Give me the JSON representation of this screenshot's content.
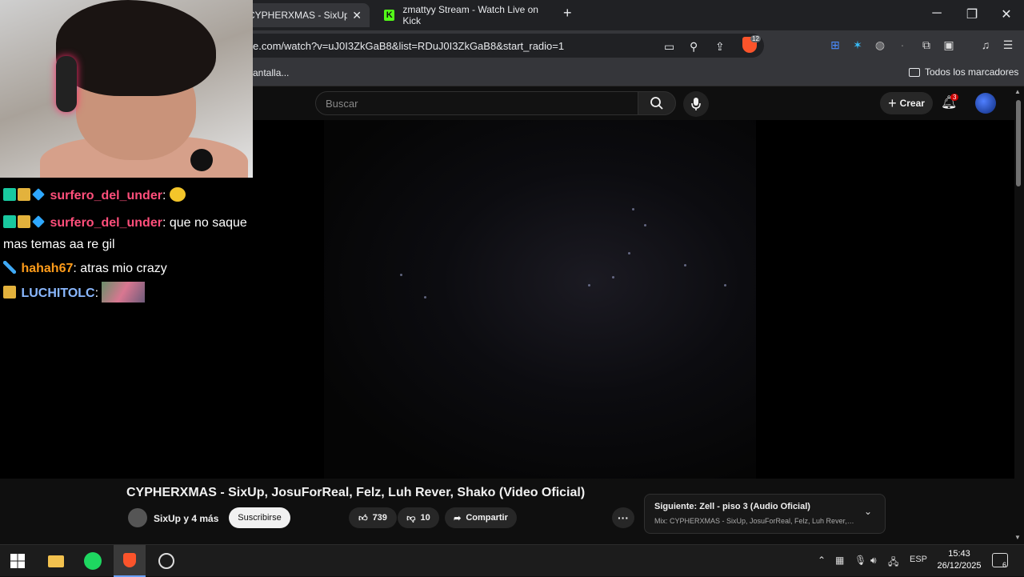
{
  "browser": {
    "tabs": [
      {
        "title": "CYPHERXMAS - SixUp, Josu"
      },
      {
        "title": "zmattyy Stream - Watch Live on Kick"
      }
    ],
    "url": "e.com/watch?v=uJ0I3ZkGaB8&list=RDuJ0I3ZkGaB8&start_radio=1",
    "bookmark_partial": "antalla...",
    "bookmarks_all": "Todos los marcadores",
    "brave_badge": "12"
  },
  "youtube": {
    "search_placeholder": "Buscar",
    "create_label": "Crear",
    "notification_count": "3",
    "video_title": "CYPHERXMAS - SixUp, JosuForReal, Felz, Luh Rever, Shako (Video Oficial)",
    "channel": "SixUp y 4 más",
    "subscribe_label": "Suscribirse",
    "likes": "739",
    "dislikes": "10",
    "share_label": "Compartir",
    "next_title": "Siguiente: Zell - piso 3 (Audio Oficial)",
    "next_sub": "Mix: CYPHERXMAS - SixUp, JosuForReal, Felz, Luh Rever, Sh..."
  },
  "chat": [
    {
      "user": "surfero_del_under",
      "message": ""
    },
    {
      "user": "surfero_del_under",
      "message": "que no saque",
      "message2": "mas temas aa re gil"
    },
    {
      "user": "hahah67",
      "message": "atras mio crazy"
    },
    {
      "user": "LUCHITOLC",
      "message": ""
    }
  ],
  "taskbar": {
    "language": "ESP",
    "time": "15:43",
    "date": "26/12/2025",
    "notifications": "6"
  }
}
